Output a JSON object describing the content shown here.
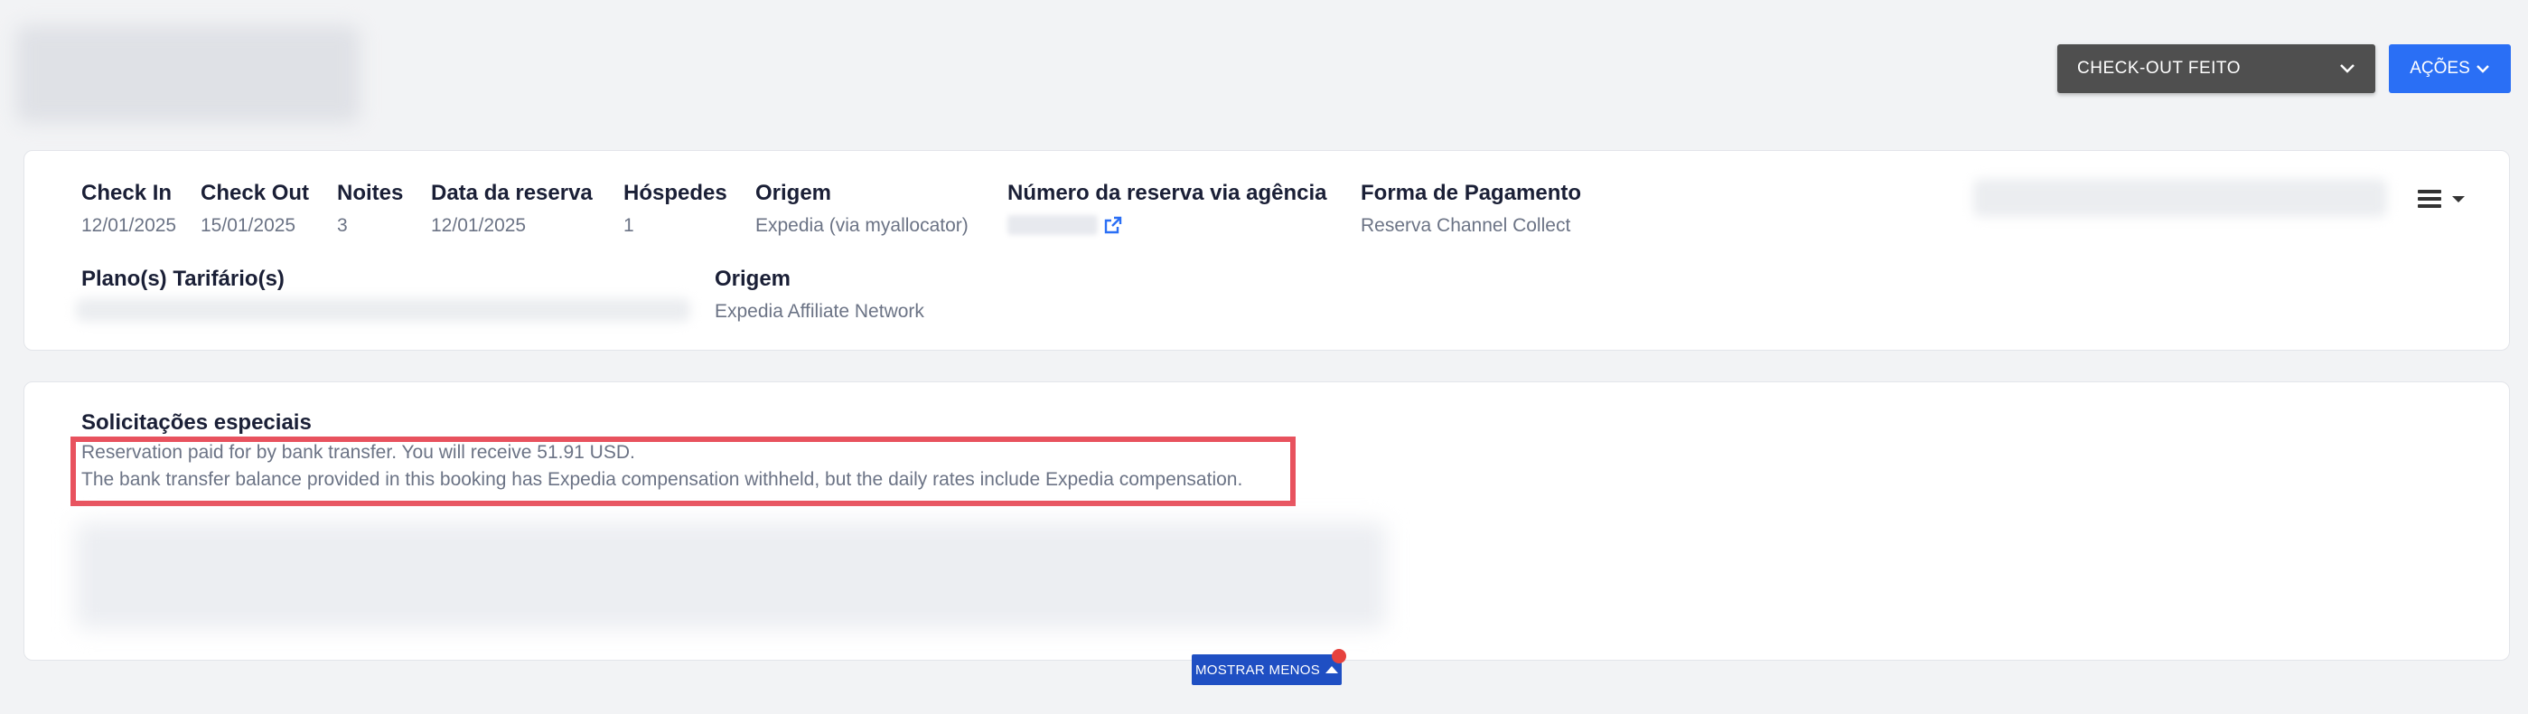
{
  "header": {
    "status_select": "CHECK-OUT FEITO",
    "actions_button": "AÇÕES"
  },
  "details": {
    "check_in": {
      "label": "Check In",
      "value": "12/01/2025"
    },
    "check_out": {
      "label": "Check Out",
      "value": "15/01/2025"
    },
    "nights": {
      "label": "Noites",
      "value": "3"
    },
    "booking_date": {
      "label": "Data da reserva",
      "value": "12/01/2025"
    },
    "guests": {
      "label": "Hóspedes",
      "value": "1"
    },
    "origin": {
      "label": "Origem",
      "value": "Expedia (via myallocator)"
    },
    "agency_number": {
      "label": "Número da reserva via agência"
    },
    "payment": {
      "label": "Forma de Pagamento",
      "value": "Reserva Channel Collect"
    },
    "rate_plans": {
      "label": "Plano(s) Tarifário(s)"
    },
    "origin2": {
      "label": "Origem",
      "value": "Expedia Affiliate Network"
    }
  },
  "special_requests": {
    "title": "Solicitações especiais",
    "line1": "Reservation paid for by bank transfer. You will receive 51.91 USD.",
    "line2": "The bank transfer balance provided in this booking has Expedia compensation withheld, but the daily rates include Expedia compensation."
  },
  "footer": {
    "show_less": "MOSTRAR MENOS"
  },
  "icons": {
    "external_link": "external-link-icon",
    "menu": "hamburger-menu-icon",
    "chevron": "chevron-down-icon"
  },
  "colors": {
    "primary": "#2a6ff5",
    "status_bg": "#4f4f4f",
    "highlight": "#e8525e",
    "show_less_bg": "#1f4fc3"
  }
}
